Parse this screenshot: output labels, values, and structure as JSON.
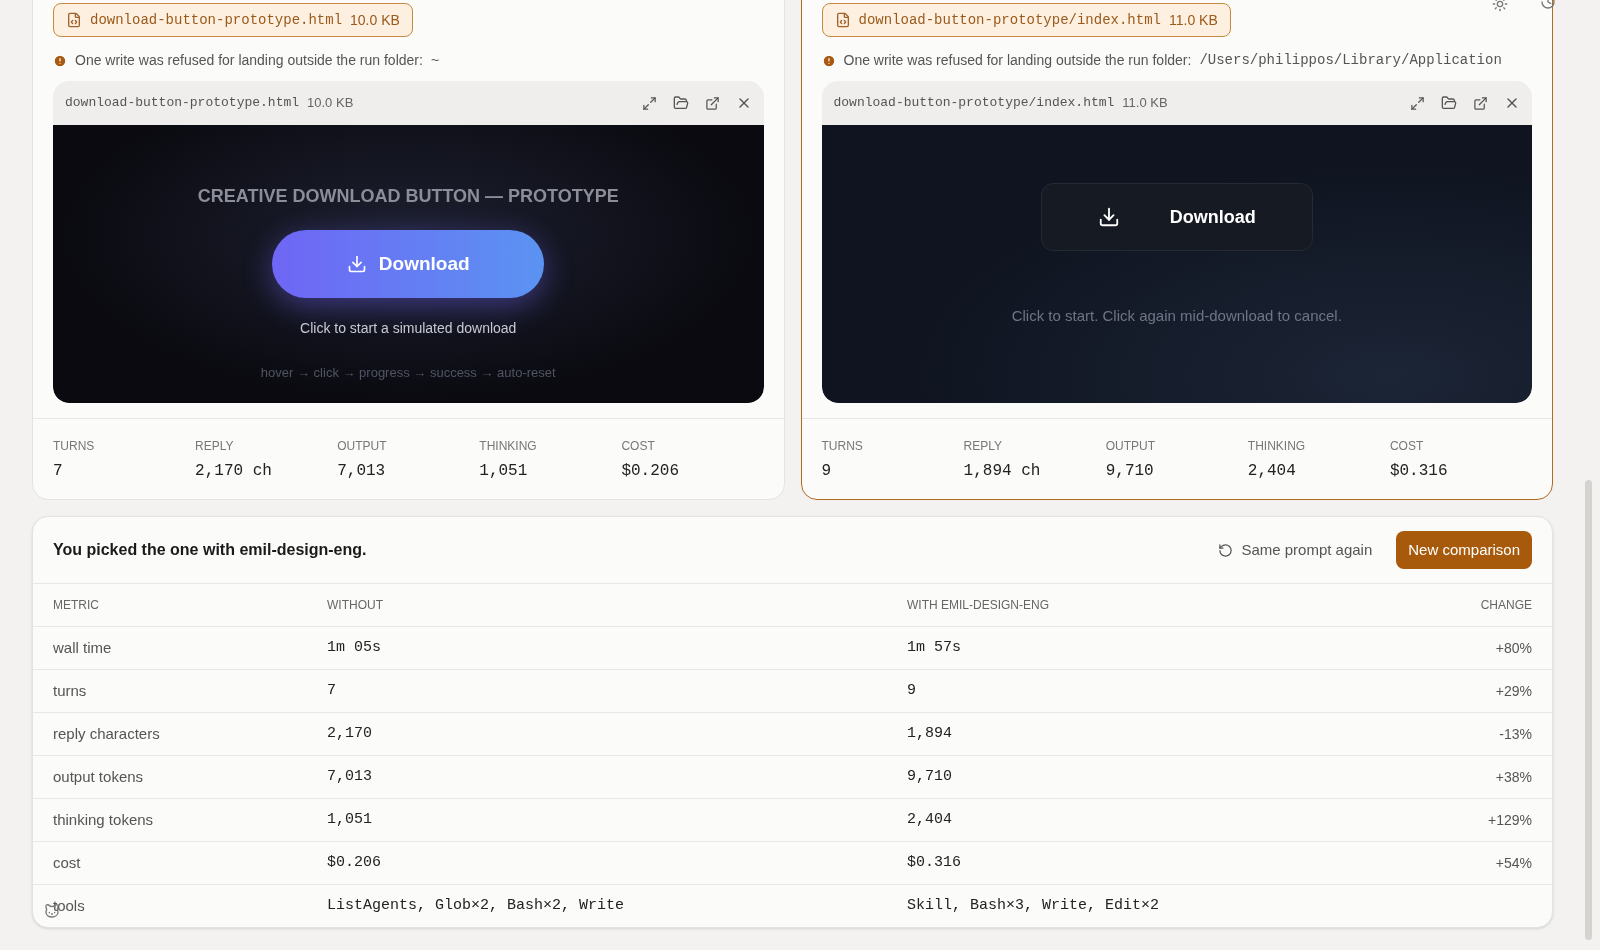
{
  "panels": [
    {
      "selected": false,
      "file_chip": {
        "name": "download-button-prototype.html",
        "size": "10.0 KB"
      },
      "warning": {
        "text": "One write was refused for landing outside the run folder:",
        "path": "~",
        "kind": "plain"
      },
      "preview": {
        "filename": "download-button-prototype.html",
        "size": "10.0 KB",
        "kind": "gradient",
        "title": "CREATIVE DOWNLOAD BUTTON — PROTOTYPE",
        "button": "Download",
        "caption": "Click to start a simulated download",
        "hint": "hover → click → progress → success → auto-reset"
      },
      "stats": [
        {
          "label": "TURNS",
          "value": "7"
        },
        {
          "label": "REPLY",
          "value": "2,170 ch"
        },
        {
          "label": "OUTPUT",
          "value": "7,013"
        },
        {
          "label": "THINKING",
          "value": "1,051"
        },
        {
          "label": "COST",
          "value": "$0.206"
        }
      ]
    },
    {
      "selected": true,
      "file_chip": {
        "name": "download-button-prototype/index.html",
        "size": "11.0 KB"
      },
      "warning": {
        "text": "One write was refused for landing outside the run folder:",
        "path": "/Users/philippos/Library/Application",
        "kind": "mono"
      },
      "preview": {
        "filename": "download-button-prototype/index.html",
        "size": "11.0 KB",
        "kind": "dark",
        "button": "Download",
        "caption": "Click to start. Click again mid-download to cancel."
      },
      "stats": [
        {
          "label": "TURNS",
          "value": "9"
        },
        {
          "label": "REPLY",
          "value": "1,894 ch"
        },
        {
          "label": "OUTPUT",
          "value": "9,710"
        },
        {
          "label": "THINKING",
          "value": "2,404"
        },
        {
          "label": "COST",
          "value": "$0.316"
        }
      ]
    }
  ],
  "result": {
    "message": "You picked the one with emil-design-eng.",
    "again_button": "Same prompt again",
    "new_button": "New comparison"
  },
  "table": {
    "columns": [
      "METRIC",
      "WITHOUT",
      "WITH EMIL-DESIGN-ENG",
      "CHANGE"
    ],
    "rows": [
      [
        "wall time",
        "1m 05s",
        "1m 57s",
        "+80%"
      ],
      [
        "turns",
        "7",
        "9",
        "+29%"
      ],
      [
        "reply characters",
        "2,170",
        "1,894",
        "-13%"
      ],
      [
        "output tokens",
        "7,013",
        "9,710",
        "+38%"
      ],
      [
        "thinking tokens",
        "1,051",
        "2,404",
        "+129%"
      ],
      [
        "cost",
        "$0.206",
        "$0.316",
        "+54%"
      ],
      [
        "tools",
        "ListAgents, Glob×2, Bash×2, Write",
        "Skill, Bash×3, Write, Edit×2"
      ]
    ]
  }
}
